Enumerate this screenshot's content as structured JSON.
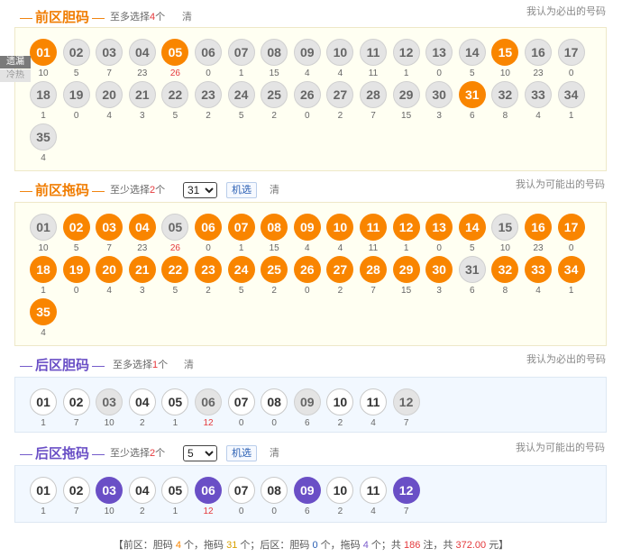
{
  "sections": [
    {
      "key": "front_dan",
      "title": "前区胆码",
      "dash": "—",
      "rule_pre": "至多选择",
      "rule_num": "4",
      "rule_post": "个",
      "has_select": false,
      "has_random": false,
      "clear_label": "清",
      "right_label": "我认为必出的号码",
      "title_color": "#f07c00",
      "theme": "front",
      "balls": [
        "01",
        "02",
        "03",
        "04",
        "05",
        "06",
        "07",
        "08",
        "09",
        "10",
        "11",
        "12",
        "13",
        "14",
        "15",
        "16",
        "17",
        "18",
        "19",
        "20",
        "21",
        "22",
        "23",
        "24",
        "25",
        "26",
        "27",
        "28",
        "29",
        "30",
        "31",
        "32",
        "33",
        "34",
        "35"
      ],
      "missing": [
        "10",
        "5",
        "7",
        "23",
        "26",
        "0",
        "1",
        "15",
        "4",
        "4",
        "11",
        "1",
        "0",
        "5",
        "10",
        "23",
        "0",
        "1",
        "0",
        "4",
        "3",
        "5",
        "2",
        "5",
        "2",
        "0",
        "2",
        "7",
        "15",
        "3",
        "6",
        "8",
        "4",
        "1",
        "4"
      ],
      "hot_indexes": [
        4
      ],
      "selected": [
        "01",
        "05",
        "15",
        "31"
      ],
      "style_on": "on-o",
      "style_off": "off"
    },
    {
      "key": "front_tuo",
      "title": "前区拖码",
      "dash": "—",
      "rule_pre": "至少选择",
      "rule_num": "2",
      "rule_post": "个",
      "has_select": true,
      "select_value": "31",
      "has_random": true,
      "random_label": "机选",
      "clear_label": "清",
      "right_label": "我认为可能出的号码",
      "title_color": "#f07c00",
      "theme": "front",
      "balls": [
        "01",
        "02",
        "03",
        "04",
        "05",
        "06",
        "07",
        "08",
        "09",
        "10",
        "11",
        "12",
        "13",
        "14",
        "15",
        "16",
        "17",
        "18",
        "19",
        "20",
        "21",
        "22",
        "23",
        "24",
        "25",
        "26",
        "27",
        "28",
        "29",
        "30",
        "31",
        "32",
        "33",
        "34",
        "35"
      ],
      "missing": [
        "10",
        "5",
        "7",
        "23",
        "26",
        "0",
        "1",
        "15",
        "4",
        "4",
        "11",
        "1",
        "0",
        "5",
        "10",
        "23",
        "0",
        "1",
        "0",
        "4",
        "3",
        "5",
        "2",
        "5",
        "2",
        "0",
        "2",
        "7",
        "15",
        "3",
        "6",
        "8",
        "4",
        "1",
        "4"
      ],
      "hot_indexes": [
        4
      ],
      "selected": [
        "02",
        "03",
        "04",
        "06",
        "07",
        "08",
        "09",
        "10",
        "11",
        "12",
        "13",
        "14",
        "16",
        "17",
        "18",
        "19",
        "20",
        "21",
        "22",
        "23",
        "24",
        "25",
        "26",
        "27",
        "28",
        "29",
        "30",
        "32",
        "33",
        "34",
        "35"
      ],
      "style_on": "on-o",
      "style_off": "off"
    },
    {
      "key": "back_dan",
      "title": "后区胆码",
      "dash": "—",
      "rule_pre": "至多选择",
      "rule_num": "1",
      "rule_post": "个",
      "has_select": false,
      "has_random": false,
      "clear_label": "清",
      "right_label": "我认为必出的号码",
      "title_color": "#6a4fc6",
      "theme": "back",
      "balls": [
        "01",
        "02",
        "03",
        "04",
        "05",
        "06",
        "07",
        "08",
        "09",
        "10",
        "11",
        "12"
      ],
      "missing": [
        "1",
        "7",
        "10",
        "2",
        "1",
        "12",
        "0",
        "0",
        "6",
        "2",
        "4",
        "7"
      ],
      "hot_indexes": [
        5
      ],
      "selected": [],
      "disabled": [
        "03",
        "06",
        "09",
        "12"
      ],
      "style_on": "on-p",
      "style_off": "w"
    },
    {
      "key": "back_tuo",
      "title": "后区拖码",
      "dash": "—",
      "rule_pre": "至少选择",
      "rule_num": "2",
      "rule_post": "个",
      "has_select": true,
      "select_value": "5",
      "has_random": true,
      "random_label": "机选",
      "clear_label": "清",
      "right_label": "我认为可能出的号码",
      "title_color": "#6a4fc6",
      "theme": "back",
      "balls": [
        "01",
        "02",
        "03",
        "04",
        "05",
        "06",
        "07",
        "08",
        "09",
        "10",
        "11",
        "12"
      ],
      "missing": [
        "1",
        "7",
        "10",
        "2",
        "1",
        "12",
        "0",
        "0",
        "6",
        "2",
        "4",
        "7"
      ],
      "hot_indexes": [
        5
      ],
      "selected": [
        "03",
        "06",
        "09",
        "12"
      ],
      "style_on": "on-p",
      "style_off": "w"
    }
  ],
  "side_tabs": {
    "missing_label": "遗漏",
    "hotcold_label": "冷热"
  },
  "summary": {
    "open": "【前区：胆码",
    "front_dan_count": "4",
    "unit1": "个，拖码",
    "front_tuo_count": "31",
    "unit2": "个；后区：胆码",
    "back_dan_count": "0",
    "unit3": "个，拖码",
    "back_tuo_count": "4",
    "unit4": "个；共",
    "bets": "186",
    "unit5": "注，共",
    "amount": "372.00",
    "close": "元】"
  }
}
